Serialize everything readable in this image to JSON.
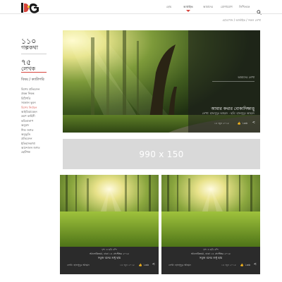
{
  "header": {
    "logo_icon": "brand-logo",
    "nav": [
      {
        "label": "হোম",
        "active": false
      },
      {
        "label": "আর্কাইভ",
        "active": true
      },
      {
        "label": "আমাদের",
        "active": false
      },
      {
        "label": "যোগাযোগ",
        "active": false
      },
      {
        "label": "লিখিতকে",
        "active": false
      }
    ],
    "search_icon": "search-icon",
    "accent_color": "#d6443c"
  },
  "breadcrumb": "হোমপেজ / আর্কাইভ / সকল লেখা",
  "sidebar": {
    "stories_count": "১১০",
    "stories_label": "গল্পকথা",
    "writers_count": "৭৫",
    "writers_label": "লেখক",
    "filter_title": "বিষয় / ক্যাটাগরি",
    "categories": [
      {
        "label": "বিশেষ প্রতিবেদন",
        "active": false
      },
      {
        "label": "প্রবন্ধ নিবন্ধ",
        "active": false
      },
      {
        "label": "চিঠিপত্রি",
        "active": false
      },
      {
        "label": "সমকাল ভুবন",
        "active": false
      },
      {
        "label": "বিশেষ নির্বাচন",
        "active": true
      },
      {
        "label": "আইডিয়াবেহন",
        "active": false
      },
      {
        "label": "ভ্রমণ কাহিনী",
        "active": false
      },
      {
        "label": "কবিতালাপ",
        "active": false
      },
      {
        "label": "অনুবাদ",
        "active": false
      },
      {
        "label": "শিশু জগত",
        "active": false
      },
      {
        "label": "অনুভূতি",
        "active": false
      },
      {
        "label": "প্রতিবেদন",
        "active": false
      },
      {
        "label": "ইতিহাসকাথা",
        "active": false
      },
      {
        "label": "আন্দোলন জগত",
        "active": false
      },
      {
        "label": "ছোটগল্প",
        "active": false
      }
    ]
  },
  "featured": {
    "category": "আমাদের লেখা",
    "title": "আমার কথার বোকাদিক্ষাত্তু",
    "author": "লেখা: হাফসুদুর আহমদ  ·  ছবি: হাফসুদুর আহমদ",
    "date": "১৪ জুন ২০১৮",
    "likes": "১৩৬",
    "like_icon": "thumbs-up-icon",
    "share_icon": "share-icon"
  },
  "ad": {
    "text": "990 x 150"
  },
  "cards": [
    {
      "category": "দৃশ্য ও ছবি বন্দি",
      "subtitle": "আলোকিতয়া, ঢাকা ১৪ সেপ্টেম্বর ২০১৮",
      "title": "সবুজ বনের শুধু ছায়",
      "author": "লেখা: হাফসুদুর আহমদ",
      "date": "১৪ জুন ২০১৮",
      "likes": "১৩৬",
      "like_icon": "thumbs-up-icon",
      "share_icon": "share-icon"
    },
    {
      "category": "দৃশ্য ও ছবি বন্দি",
      "subtitle": "আলোকিতয়া, ঢাকা ১৪ সেপ্টেম্বর ২০১৮",
      "title": "সবুজ বনের শুধু ছায়",
      "author": "লেখা: হাফসুদুর আহমদ",
      "date": "১৪ জুন ২০১৮",
      "likes": "১৩৬",
      "like_icon": "thumbs-up-icon",
      "share_icon": "share-icon"
    }
  ]
}
